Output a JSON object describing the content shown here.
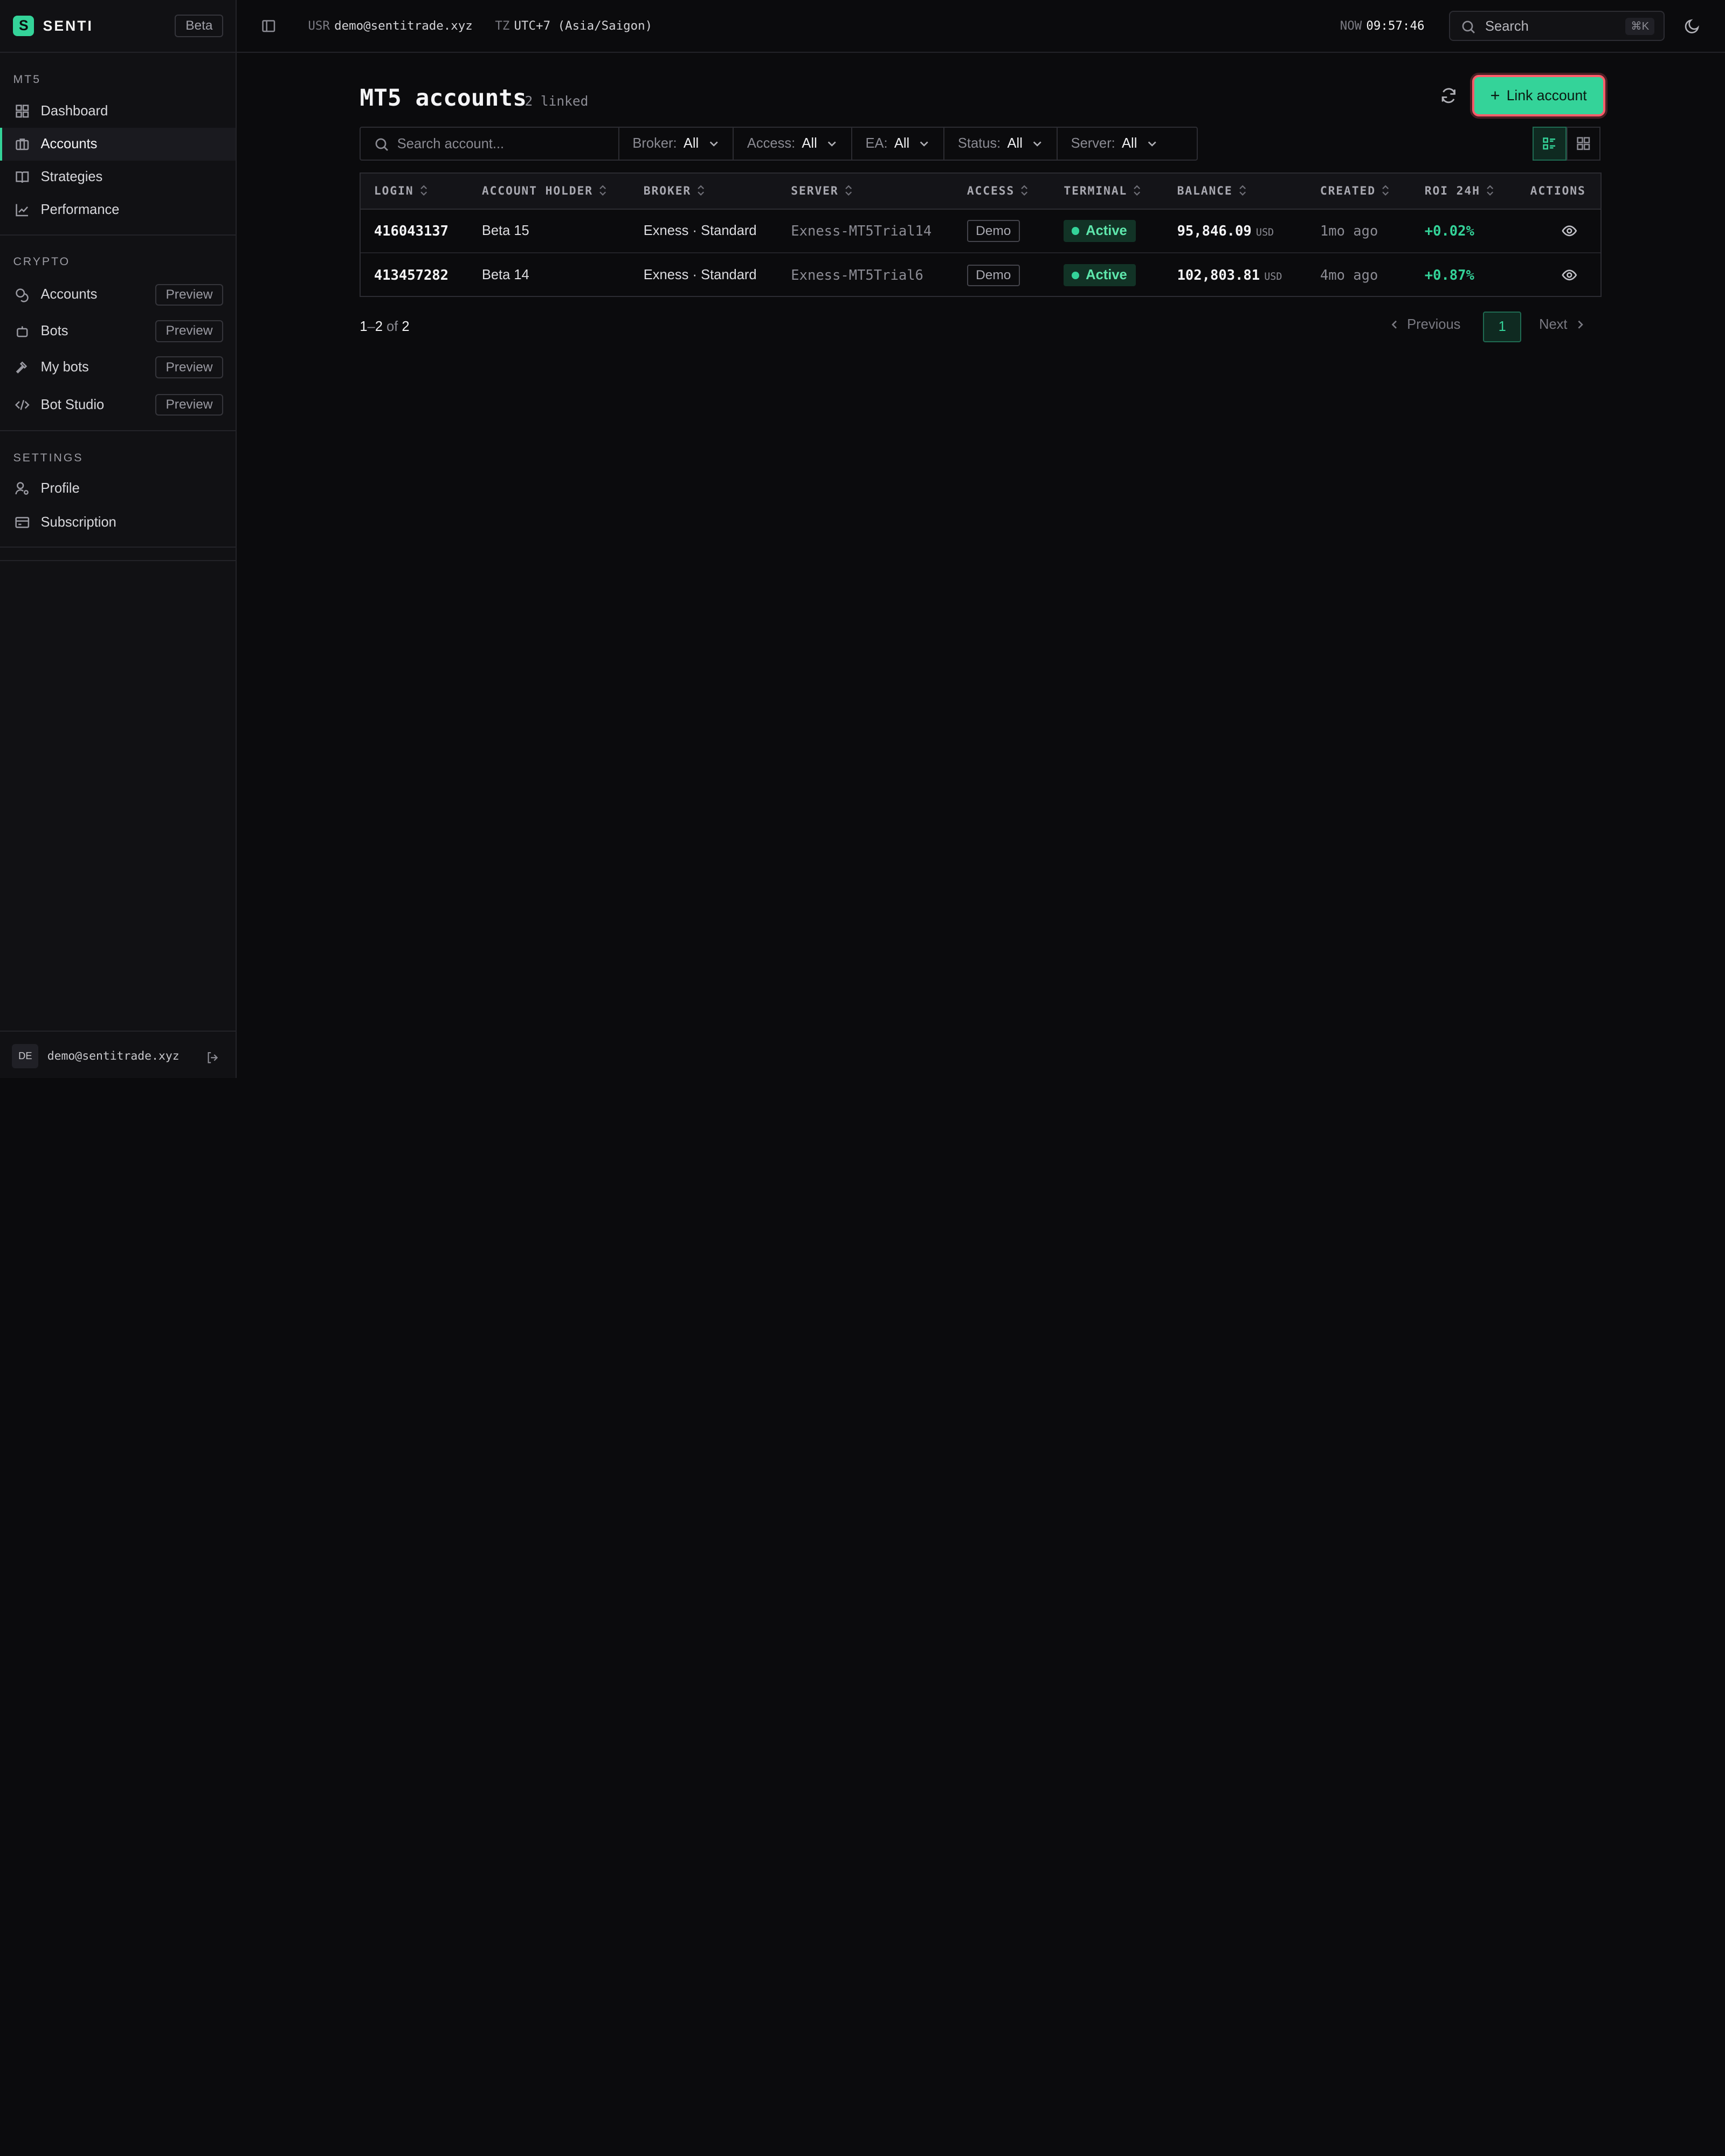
{
  "brand": {
    "name": "SENTI",
    "badge": "Beta",
    "logo_letter": "S"
  },
  "sidebar": {
    "sections": [
      {
        "label": "MT5",
        "items": [
          {
            "label": "Dashboard",
            "icon": "grid-icon"
          },
          {
            "label": "Accounts",
            "icon": "briefcase-icon",
            "active": true
          },
          {
            "label": "Strategies",
            "icon": "book-icon"
          },
          {
            "label": "Performance",
            "icon": "line-chart-icon"
          }
        ]
      },
      {
        "label": "CRYPTO",
        "items": [
          {
            "label": "Accounts",
            "icon": "coins-icon",
            "badge": "Preview"
          },
          {
            "label": "Bots",
            "icon": "bot-icon",
            "badge": "Preview"
          },
          {
            "label": "My bots",
            "icon": "hammer-icon",
            "badge": "Preview"
          },
          {
            "label": "Bot Studio",
            "icon": "code-icon",
            "badge": "Preview"
          }
        ]
      },
      {
        "label": "SETTINGS",
        "items": [
          {
            "label": "Profile",
            "icon": "user-cog-icon"
          },
          {
            "label": "Subscription",
            "icon": "card-icon"
          }
        ]
      }
    ],
    "footer": {
      "avatar": "DE",
      "email": "demo@sentitrade.xyz"
    }
  },
  "header": {
    "user_key": "USR",
    "user_value": "demo@sentitrade.xyz",
    "tz_key": "TZ",
    "tz_value": "UTC+7 (Asia/Saigon)",
    "now_key": "NOW",
    "now_value": "09:57:46",
    "search_label": "Search",
    "search_kbd": "⌘K"
  },
  "page": {
    "title": "MT5 accounts",
    "linked_count": "2 linked",
    "link_button": "Link account",
    "search_placeholder": "Search account...",
    "filters": [
      {
        "label": "Broker:",
        "value": "All"
      },
      {
        "label": "Access:",
        "value": "All"
      },
      {
        "label": "EA:",
        "value": "All"
      },
      {
        "label": "Status:",
        "value": "All"
      },
      {
        "label": "Server:",
        "value": "All"
      }
    ]
  },
  "table": {
    "columns": [
      "LOGIN",
      "ACCOUNT HOLDER",
      "BROKER",
      "SERVER",
      "ACCESS",
      "TERMINAL",
      "BALANCE",
      "CREATED",
      "ROI 24H",
      "ACTIONS"
    ],
    "rows": [
      {
        "login": "416043137",
        "holder": "Beta 15",
        "broker": "Exness · Standard",
        "server": "Exness-MT5Trial14",
        "access": "Demo",
        "terminal": "Active",
        "balance": "95,846.09",
        "currency": "USD",
        "created": "1mo ago",
        "roi": "+0.02%"
      },
      {
        "login": "413457282",
        "holder": "Beta 14",
        "broker": "Exness · Standard",
        "server": "Exness-MT5Trial6",
        "access": "Demo",
        "terminal": "Active",
        "balance": "102,803.81",
        "currency": "USD",
        "created": "4mo ago",
        "roi": "+0.87%"
      }
    ]
  },
  "pagination": {
    "range_start": "1",
    "range_sep": "–",
    "range_end": "2",
    "of_word": "of",
    "total": "2",
    "previous": "Previous",
    "current_page": "1",
    "next": "Next"
  },
  "colors": {
    "accent": "#34d399",
    "background": "#0b0b0d",
    "sidebar": "#111114",
    "focus_ring": "#ff5c6a"
  }
}
